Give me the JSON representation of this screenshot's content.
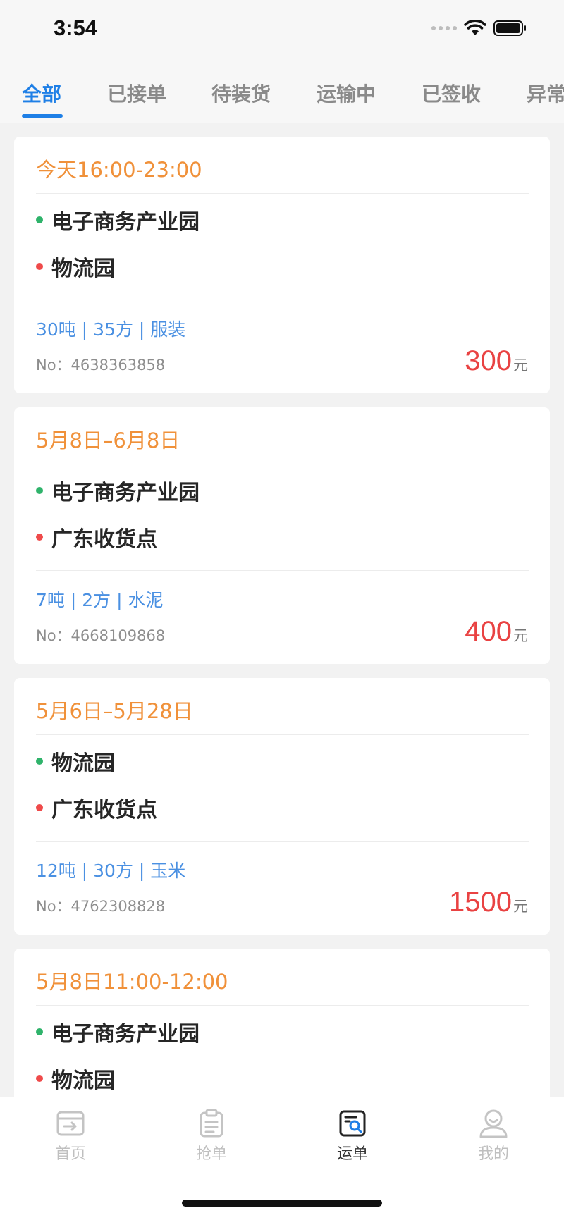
{
  "status_bar": {
    "time": "3:54"
  },
  "tabs": [
    {
      "label": "全部",
      "active": true
    },
    {
      "label": "已接单"
    },
    {
      "label": "待装货"
    },
    {
      "label": "运输中"
    },
    {
      "label": "已签收"
    },
    {
      "label": "异常"
    }
  ],
  "orders": [
    {
      "date": "今天16:00-23:00",
      "from": "电子商务产业园",
      "to": "物流园",
      "spec": "30吨 | 35方 | 服装",
      "no": "No：4638363858",
      "price": "300",
      "unit": "元"
    },
    {
      "date": "5月8日–6月8日",
      "from": "电子商务产业园",
      "to": "广东收货点",
      "spec": "7吨 | 2方 | 水泥",
      "no": "No：4668109868",
      "price": "400",
      "unit": "元"
    },
    {
      "date": "5月6日–5月28日",
      "from": "物流园",
      "to": "广东收货点",
      "spec": "12吨 | 30方 | 玉米",
      "no": "No：4762308828",
      "price": "1500",
      "unit": "元"
    },
    {
      "date": "5月8日11:00-12:00",
      "from": "电子商务产业园",
      "to": "物流园"
    }
  ],
  "bottom_nav": [
    {
      "label": "首页",
      "icon": "home-icon"
    },
    {
      "label": "抢单",
      "icon": "clipboard-icon"
    },
    {
      "label": "运单",
      "icon": "waybill-search-icon",
      "active": true
    },
    {
      "label": "我的",
      "icon": "profile-icon"
    }
  ],
  "colors": {
    "accent": "#1e7fe6",
    "date": "#f0913a",
    "spec": "#4a90e2",
    "price": "#e94242",
    "origin_dot": "#2fb36b",
    "destination_dot": "#ef4a4a"
  }
}
